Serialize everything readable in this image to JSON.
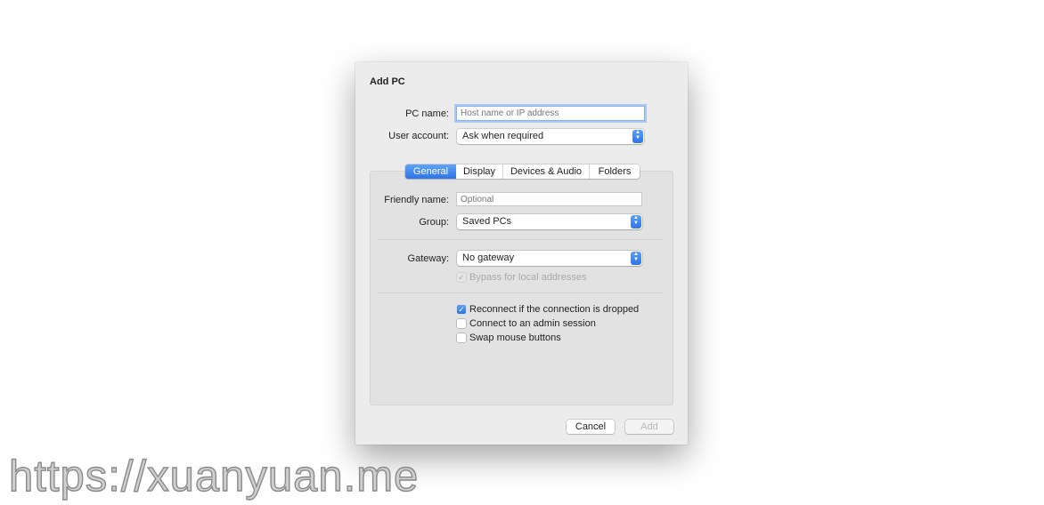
{
  "dialog": {
    "title": "Add PC",
    "pc_name": {
      "label": "PC name:",
      "value": "",
      "placeholder": "Host name or IP address"
    },
    "user_account": {
      "label": "User account:",
      "value": "Ask when required"
    },
    "tabs": [
      "General",
      "Display",
      "Devices & Audio",
      "Folders"
    ],
    "active_tab": "General",
    "friendly_name": {
      "label": "Friendly name:",
      "value": "",
      "placeholder": "Optional"
    },
    "group": {
      "label": "Group:",
      "value": "Saved PCs"
    },
    "gateway": {
      "label": "Gateway:",
      "value": "No gateway"
    },
    "bypass": {
      "label": "Bypass for local addresses",
      "checked": true,
      "disabled": true
    },
    "options": [
      {
        "label": "Reconnect if the connection is dropped",
        "checked": true
      },
      {
        "label": "Connect to an admin session",
        "checked": false
      },
      {
        "label": "Swap mouse buttons",
        "checked": false
      }
    ],
    "cancel_label": "Cancel",
    "add_label": "Add"
  },
  "watermark": "https://xuanyuan.me",
  "colors": {
    "accent": "#2f73e6",
    "dialog_bg": "#ececec",
    "panel_bg": "#e2e2e2"
  }
}
